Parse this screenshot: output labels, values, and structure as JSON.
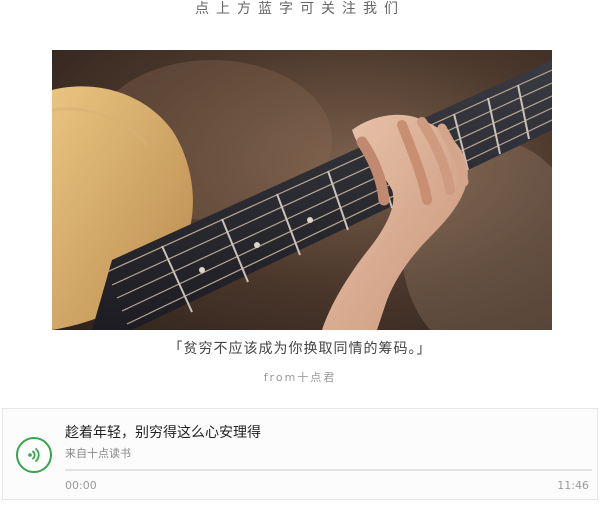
{
  "header": {
    "follow_hint": "点上方蓝字可关注我们"
  },
  "hero_image": {
    "subject": "hand-playing-acoustic-guitar"
  },
  "quote": {
    "text": "「贫穷不应该成为你换取同情的筹码。」",
    "source": "from十点君"
  },
  "audio": {
    "title": "趁着年轻，别穷得这么心安理得",
    "from": "来自十点读书",
    "current_time": "00:00",
    "duration": "11:46",
    "progress": 0,
    "play_icon": "audio-wave-icon",
    "accent_color": "#35a64a"
  }
}
